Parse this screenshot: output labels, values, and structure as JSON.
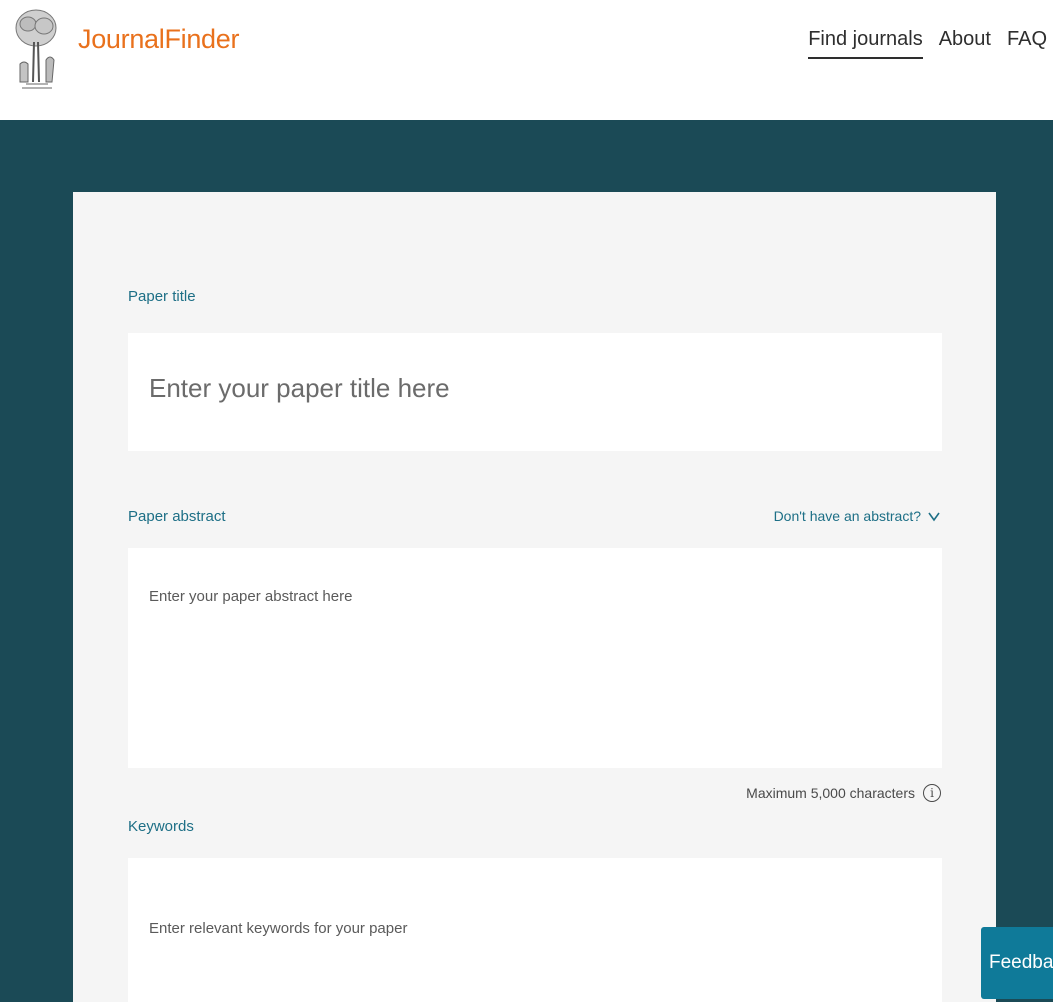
{
  "header": {
    "logo_icon": "elsevier-tree-logo",
    "brand": "JournalFinder",
    "brand_color": "#e9711c",
    "nav": [
      {
        "label": "Find journals",
        "active": true
      },
      {
        "label": "About",
        "active": false
      },
      {
        "label": "FAQ",
        "active": false
      }
    ]
  },
  "band_color": "#1b4a56",
  "form": {
    "title_label": "Paper title",
    "title_placeholder": "Enter your paper title here",
    "abstract_label": "Paper abstract",
    "no_abstract_link": "Don't have an abstract?",
    "abstract_placeholder": "Enter your paper abstract here",
    "max_chars_note": "Maximum 5,000 characters",
    "keywords_label": "Keywords",
    "keywords_placeholder": "Enter relevant keywords for your paper"
  },
  "feedback_label": "Feedback",
  "feedback_color": "#0f7a99"
}
